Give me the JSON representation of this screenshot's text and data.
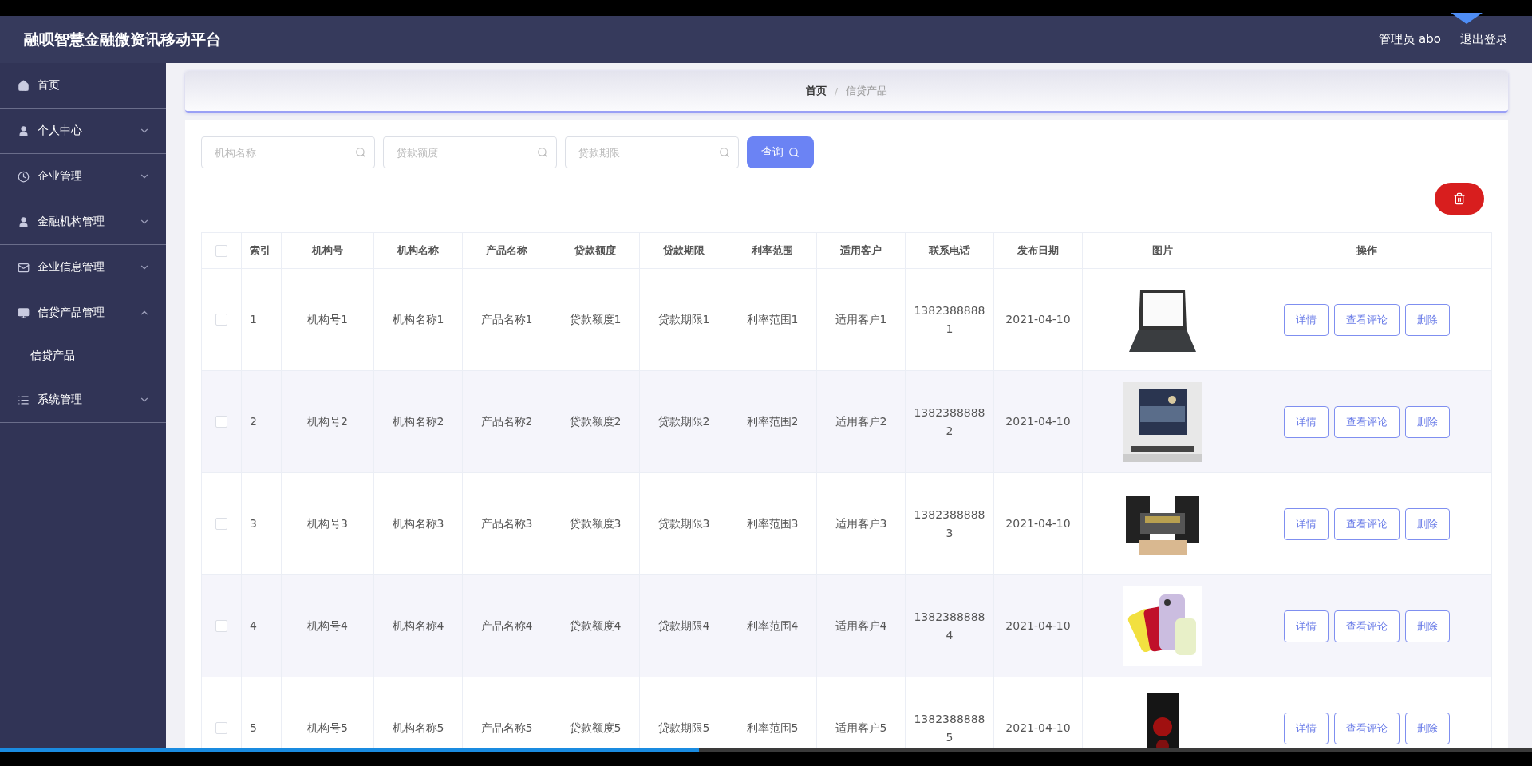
{
  "header": {
    "title": "融呗智慧金融微资讯移动平台",
    "user": "管理员 abo",
    "logout": "退出登录"
  },
  "sidebar": {
    "items": [
      {
        "label": "首页"
      },
      {
        "label": "个人中心",
        "expanded": false
      },
      {
        "label": "企业管理",
        "expanded": false
      },
      {
        "label": "金融机构管理",
        "expanded": false
      },
      {
        "label": "企业信息管理",
        "expanded": false
      },
      {
        "label": "信贷产品管理",
        "expanded": true,
        "children": [
          {
            "label": "信贷产品"
          }
        ]
      },
      {
        "label": "系统管理",
        "expanded": false
      }
    ]
  },
  "breadcrumb": [
    "首页",
    "信贷产品"
  ],
  "breadcrumb_separator": "/",
  "search": {
    "fields": [
      {
        "placeholder": "机构名称"
      },
      {
        "placeholder": "贷款额度"
      },
      {
        "placeholder": "贷款期限"
      }
    ],
    "button": "查询"
  },
  "table": {
    "header_checked": false,
    "columns": [
      "索引",
      "机构号",
      "机构名称",
      "产品名称",
      "贷款额度",
      "贷款期限",
      "利率范围",
      "适用客户",
      "联系电话",
      "发布日期",
      "图片",
      "操作"
    ],
    "rows": [
      {
        "checked": false,
        "cells": [
          "1",
          "机构号1",
          "机构名称1",
          "产品名称1",
          "贷款额度1",
          "贷款期限1",
          "利率范围1",
          "适用客户1",
          "13823888881",
          "2021-04-10"
        ],
        "actions": [
          "详情",
          "查看评论",
          "删除"
        ]
      },
      {
        "checked": false,
        "cells": [
          "2",
          "机构号2",
          "机构名称2",
          "产品名称2",
          "贷款额度2",
          "贷款期限2",
          "利率范围2",
          "适用客户2",
          "13823888882",
          "2021-04-10"
        ],
        "actions": [
          "详情",
          "查看评论",
          "删除"
        ]
      },
      {
        "checked": false,
        "cells": [
          "3",
          "机构号3",
          "机构名称3",
          "产品名称3",
          "贷款额度3",
          "贷款期限3",
          "利率范围3",
          "适用客户3",
          "13823888883",
          "2021-04-10"
        ],
        "actions": [
          "详情",
          "查看评论",
          "删除"
        ]
      },
      {
        "checked": false,
        "cells": [
          "4",
          "机构号4",
          "机构名称4",
          "产品名称4",
          "贷款额度4",
          "贷款期限4",
          "利率范围4",
          "适用客户4",
          "13823888884",
          "2021-04-10"
        ],
        "actions": [
          "详情",
          "查看评论",
          "删除"
        ]
      },
      {
        "checked": false,
        "cells": [
          "5",
          "机构号5",
          "机构名称5",
          "产品名称5",
          "贷款额度5",
          "贷款期限5",
          "利率范围5",
          "适用客户5",
          "13823888885",
          "2021-04-10"
        ],
        "actions": [
          "详情",
          "查看评论",
          "删除"
        ]
      }
    ]
  },
  "player": {
    "level": 0.456
  }
}
